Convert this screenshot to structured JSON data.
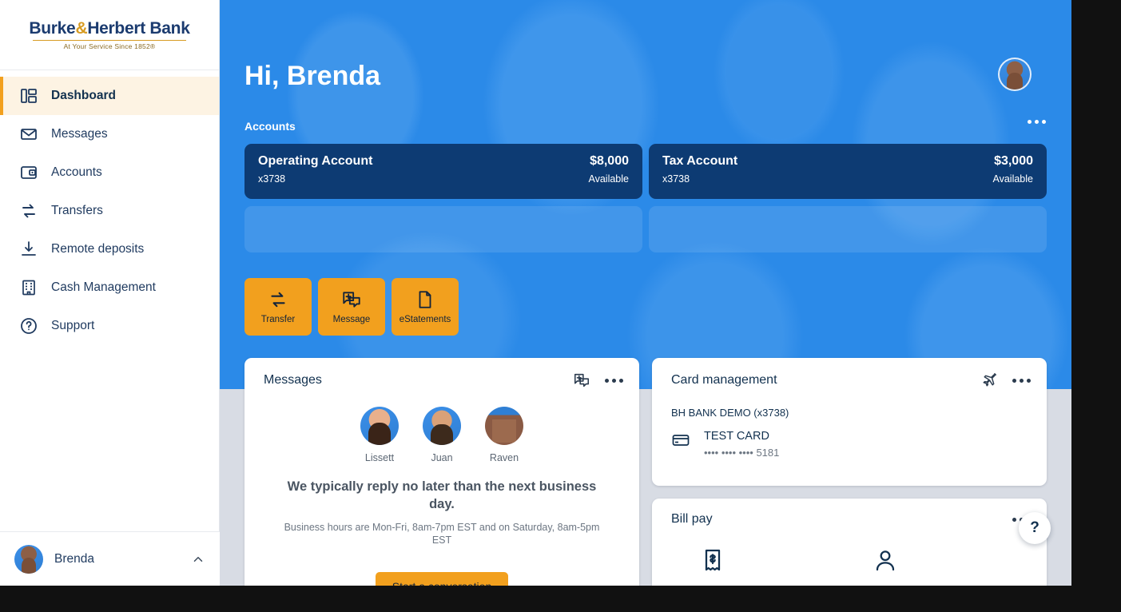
{
  "brand": {
    "name_part1": "Burke",
    "amp": "&",
    "name_part2": "Herbert Bank",
    "tagline": "At Your Service Since 1852®",
    "colors": {
      "navy": "#1b3b6f",
      "gold": "#d79b22",
      "hero_blue": "#2b8ae8",
      "card_navy": "#0d3b73",
      "accent_orange": "#f2a01e",
      "active_row": "#fdf3e3",
      "page_bg": "#d8dce4"
    }
  },
  "sidebar": {
    "items": [
      {
        "label": "Dashboard",
        "icon": "dashboard-icon",
        "active": true
      },
      {
        "label": "Messages",
        "icon": "envelope-icon",
        "active": false
      },
      {
        "label": "Accounts",
        "icon": "wallet-icon",
        "active": false
      },
      {
        "label": "Transfers",
        "icon": "transfer-arrows-icon",
        "active": false
      },
      {
        "label": "Remote deposits",
        "icon": "download-icon",
        "active": false
      },
      {
        "label": "Cash Management",
        "icon": "building-icon",
        "active": false
      },
      {
        "label": "Support",
        "icon": "question-circle-icon",
        "active": false
      }
    ],
    "user": {
      "name": "Brenda",
      "chevron": "chevron-up-icon",
      "avatar": "user-avatar"
    }
  },
  "hero": {
    "greeting": "Hi, Brenda",
    "avatar": "profile-avatar",
    "accounts_label": "Accounts",
    "accounts_menu": "kebab-menu-icon",
    "accounts": [
      {
        "name": "Operating Account",
        "number": "x3738",
        "balance": "$8,000",
        "balance_label": "Available"
      },
      {
        "name": "Tax Account",
        "number": "x3738",
        "balance": "$3,000",
        "balance_label": "Available"
      }
    ],
    "quick_actions": [
      {
        "label": "Transfer",
        "icon": "transfer-arrows-icon"
      },
      {
        "label": "Message",
        "icon": "new-message-icon"
      },
      {
        "label": "eStatements",
        "icon": "document-icon"
      }
    ]
  },
  "messages_card": {
    "title": "Messages",
    "new_message_icon": "new-message-icon",
    "menu_icon": "kebab-menu-icon",
    "agents": [
      {
        "name": "Lissett"
      },
      {
        "name": "Juan"
      },
      {
        "name": "Raven"
      }
    ],
    "headline": "We typically reply no later than the next business day.",
    "subtext": "Business hours are Mon-Fri, 8am-7pm EST and on Saturday, 8am-5pm EST",
    "cta_label": "Start a conversation"
  },
  "card_management": {
    "title": "Card management",
    "travel_icon": "airplane-icon",
    "menu_icon": "kebab-menu-icon",
    "account_label": "BH BANK DEMO (x3738)",
    "card_icon": "credit-card-icon",
    "card_name": "TEST CARD",
    "card_mask": "•••• •••• •••• 5181"
  },
  "bill_pay": {
    "title": "Bill pay",
    "menu_icon": "kebab-menu-icon",
    "icons": [
      {
        "name": "bill-receipt-icon"
      },
      {
        "name": "payee-person-icon"
      }
    ]
  },
  "help": {
    "label": "?"
  }
}
